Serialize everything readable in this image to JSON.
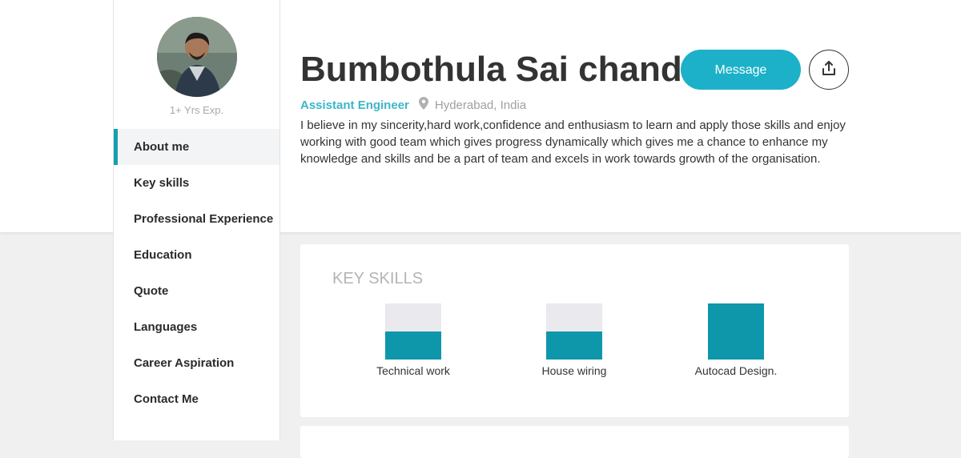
{
  "profile": {
    "name": "Bumbothula Sai chand",
    "role": "Assistant Engineer",
    "location": "Hyderabad, India",
    "experience": "1+ Yrs Exp.",
    "bio": "I believe in my sincerity,hard work,confidence and enthusiasm to learn and apply those skills and enjoy working with good team which gives progress dynamically which gives me a chance to enhance my knowledge and skills and be a part of team and excels in work towards growth of the organisation."
  },
  "actions": {
    "message_label": "Message"
  },
  "sidebar": {
    "items": [
      {
        "label": "About me",
        "active": true
      },
      {
        "label": "Key skills"
      },
      {
        "label": "Professional Experience"
      },
      {
        "label": "Education"
      },
      {
        "label": "Quote"
      },
      {
        "label": "Languages"
      },
      {
        "label": "Career Aspiration"
      },
      {
        "label": "Contact Me"
      }
    ]
  },
  "key_skills": {
    "title": "KEY SKILLS",
    "items": [
      {
        "label": "Technical work",
        "level": 0.5
      },
      {
        "label": "House wiring",
        "level": 0.5
      },
      {
        "label": "Autocad Design.",
        "level": 1.0
      }
    ]
  },
  "colors": {
    "accent": "#1cb1c9",
    "skill_fill": "#0e97ab",
    "role_text": "#3cb6c9"
  },
  "icons": {
    "location": "map-pin-icon",
    "share": "share-upload-icon"
  }
}
